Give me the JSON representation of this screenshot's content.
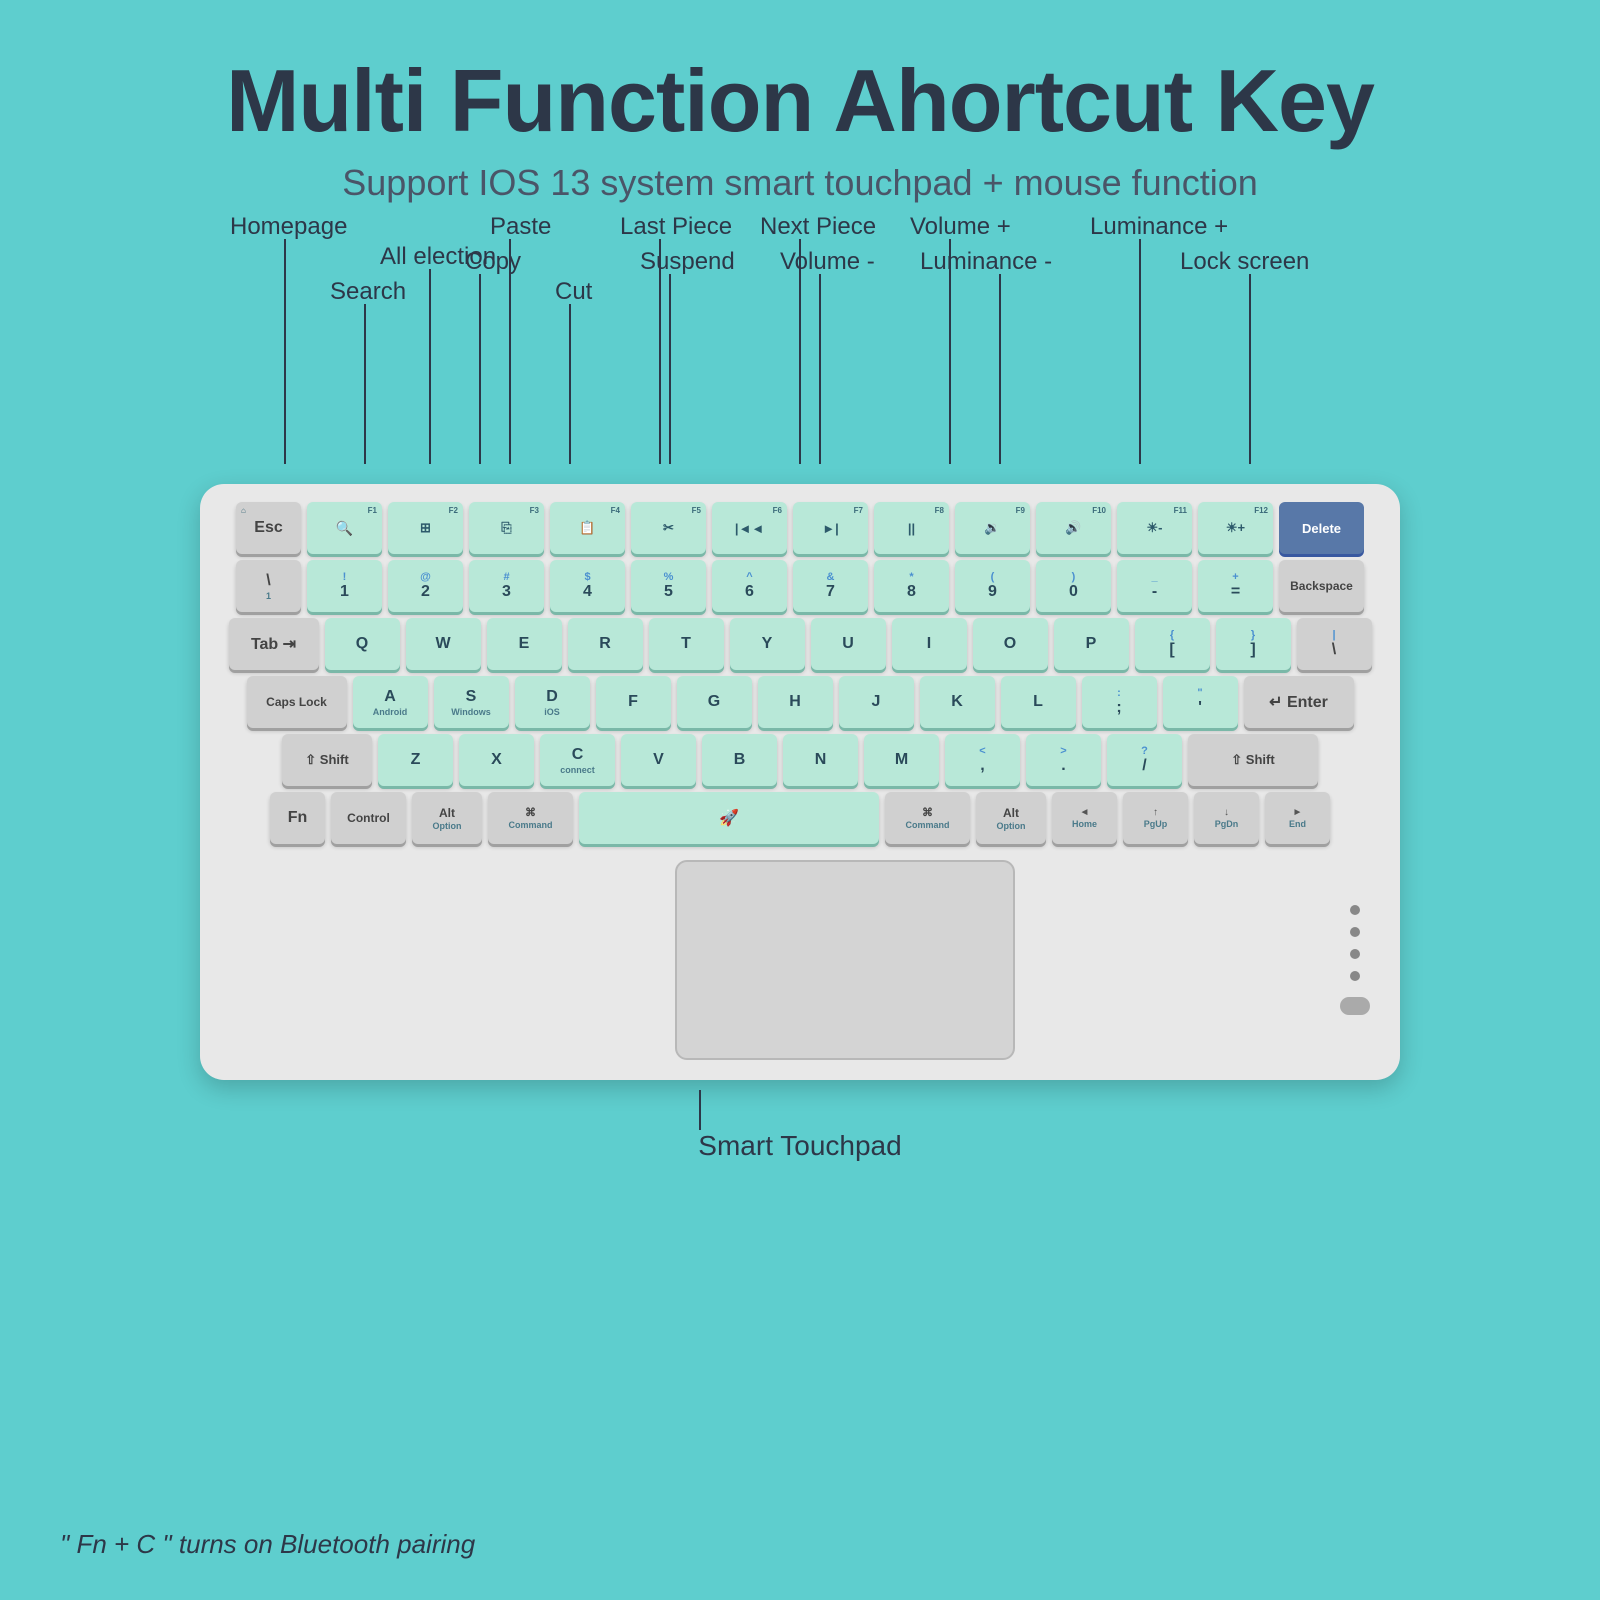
{
  "title": "Multi Function Ahortcut Key",
  "subtitle": "Support IOS 13 system smart touchpad + mouse function",
  "labels": {
    "top_row": [
      {
        "id": "homepage",
        "text": "Homepage"
      },
      {
        "id": "all_election",
        "text": "All election"
      },
      {
        "id": "paste",
        "text": "Paste"
      },
      {
        "id": "last_piece",
        "text": "Last Piece"
      },
      {
        "id": "next_piece",
        "text": "Next Piece"
      },
      {
        "id": "volume_plus",
        "text": "Volume +"
      },
      {
        "id": "luminance_plus",
        "text": "Luminance +"
      }
    ],
    "bottom_row": [
      {
        "id": "search",
        "text": "Search"
      },
      {
        "id": "copy",
        "text": "Copy"
      },
      {
        "id": "cut",
        "text": "Cut"
      },
      {
        "id": "suspend",
        "text": "Suspend"
      },
      {
        "id": "volume_minus",
        "text": "Volume -"
      },
      {
        "id": "luminance_minus",
        "text": "Luminance -"
      },
      {
        "id": "lock_screen",
        "text": "Lock screen"
      }
    ]
  },
  "keyboard": {
    "rows": [
      {
        "id": "fn_row",
        "keys": [
          "Esc",
          "F1",
          "F2",
          "F3",
          "F4",
          "F5",
          "F6",
          "F7",
          "F8",
          "F9",
          "F10",
          "F11",
          "F12",
          "Delete"
        ]
      },
      {
        "id": "number_row",
        "keys": [
          "`",
          "1",
          "2",
          "3",
          "4",
          "5",
          "6",
          "7",
          "8",
          "9",
          "0",
          "-",
          "=",
          "Backspace"
        ]
      },
      {
        "id": "qwerty_row",
        "keys": [
          "Tab",
          "Q",
          "W",
          "E",
          "R",
          "T",
          "Y",
          "U",
          "I",
          "O",
          "P",
          "[",
          "]",
          "\\"
        ]
      },
      {
        "id": "home_row",
        "keys": [
          "Caps Lock",
          "A",
          "S",
          "D",
          "F",
          "G",
          "H",
          "J",
          "K",
          "L",
          ";",
          "'",
          "Enter"
        ]
      },
      {
        "id": "shift_row",
        "keys": [
          "Shift",
          "Z",
          "X",
          "C",
          "V",
          "B",
          "N",
          "M",
          ",",
          ".",
          "/",
          "Shift"
        ]
      },
      {
        "id": "bottom_row",
        "keys": [
          "Fn",
          "Control",
          "Option",
          "Command",
          "Space",
          "Command",
          "Option",
          "Home",
          "PgUp",
          "PgDn",
          "End"
        ]
      }
    ]
  },
  "touchpad_label": "Smart Touchpad",
  "bottom_note": "\" Fn + C \" turns on Bluetooth pairing",
  "colors": {
    "background": "#5ecece",
    "key_green": "#b8e8d8",
    "key_gray": "#d0d0d0",
    "title_color": "#2d3748",
    "subtitle_color": "#4a5568"
  }
}
